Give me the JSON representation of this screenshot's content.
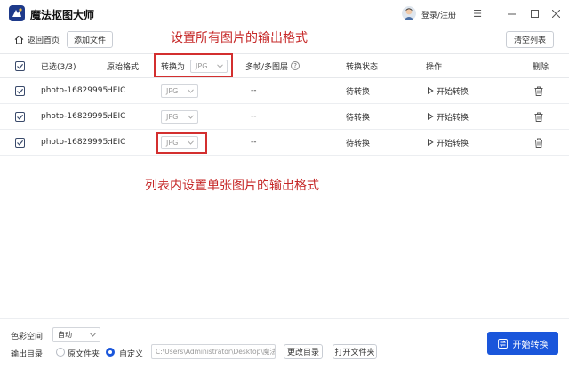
{
  "app": {
    "title": "魔法抠图大师",
    "login": "登录/注册"
  },
  "toolbar": {
    "home": "返回首页",
    "add_file": "添加文件",
    "clear_list": "清空列表"
  },
  "annotations": {
    "top": "设置所有图片的输出格式",
    "middle": "列表内设置单张图片的输出格式"
  },
  "table": {
    "headers": {
      "selected": "已选(3/3)",
      "original_format": "原始格式",
      "convert_to": "转换为",
      "convert_to_value": "JPG",
      "multiframe": "多帧/多图层",
      "status": "转换状态",
      "action": "操作",
      "delete": "删除"
    },
    "rows": [
      {
        "name": "photo-16829995...",
        "format": "HEIC",
        "target": "JPG",
        "multiframe": "--",
        "status": "待转换",
        "action": "开始转换"
      },
      {
        "name": "photo-16829995...",
        "format": "HEIC",
        "target": "JPG",
        "multiframe": "--",
        "status": "待转换",
        "action": "开始转换"
      },
      {
        "name": "photo-16829995...",
        "format": "HEIC",
        "target": "JPG",
        "multiframe": "--",
        "status": "待转换",
        "action": "开始转换"
      }
    ]
  },
  "footer": {
    "color_space_label": "色彩空间:",
    "color_space_value": "自动",
    "output_dir_label": "输出目录:",
    "option_original": "原文件夹",
    "option_custom": "自定义",
    "path": "C:\\Users\\Administrator\\Desktop\\魔法抠",
    "change_dir": "更改目录",
    "open_folder": "打开文件夹",
    "start": "开始转换"
  },
  "colors": {
    "accent": "#1a56db",
    "annotation": "#c62828"
  }
}
